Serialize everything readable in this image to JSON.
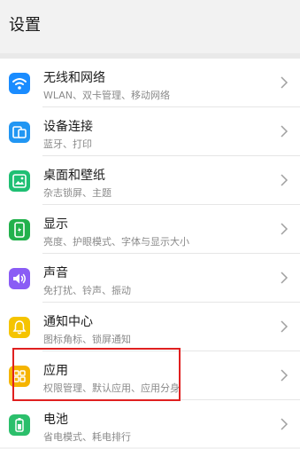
{
  "header": {
    "title": "设置"
  },
  "colors": {
    "wifi": "#1a8cff",
    "device": "#2196f3",
    "wallpaper": "#1fbf73",
    "display": "#22b14c",
    "sound": "#8a5cf5",
    "notification": "#f5c400",
    "apps": "#f5b400",
    "battery": "#2bbf6b",
    "highlight": "#e02020"
  },
  "items": [
    {
      "label": "无线和网络",
      "sub": "WLAN、双卡管理、移动网络",
      "icon": "wifi-icon"
    },
    {
      "label": "设备连接",
      "sub": "蓝牙、打印",
      "icon": "device-connection-icon"
    },
    {
      "label": "桌面和壁纸",
      "sub": "杂志锁屏、主题",
      "icon": "wallpaper-icon"
    },
    {
      "label": "显示",
      "sub": "亮度、护眼模式、字体与显示大小",
      "icon": "display-icon"
    },
    {
      "label": "声音",
      "sub": "免打扰、铃声、振动",
      "icon": "sound-icon"
    },
    {
      "label": "通知中心",
      "sub": "图标角标、锁屏通知",
      "icon": "bell-icon"
    },
    {
      "label": "应用",
      "sub": "权限管理、默认应用、应用分身",
      "icon": "apps-icon"
    },
    {
      "label": "电池",
      "sub": "省电模式、耗电排行",
      "icon": "battery-icon"
    }
  ]
}
